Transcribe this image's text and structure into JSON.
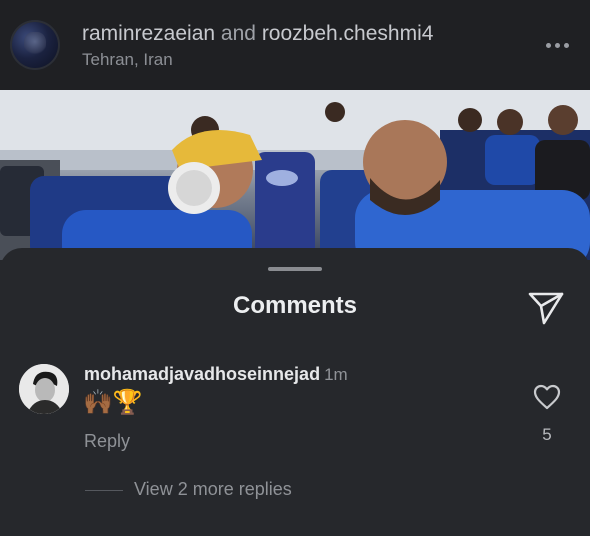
{
  "post": {
    "user1": "raminrezaeian",
    "joiner": "and",
    "user2": "roozbeh.cheshmi4",
    "location": "Tehran, Iran",
    "more_icon": "more-horizontal-icon"
  },
  "comments_sheet": {
    "title": "Comments",
    "share_icon": "paper-plane-icon"
  },
  "comment": {
    "username": "mohamadjavadhoseinnejad",
    "time": "1m",
    "text": "🙌🏾🏆",
    "reply_label": "Reply",
    "like_icon": "heart-outline-icon",
    "like_count": "5",
    "view_replies": "View 2 more replies"
  },
  "colors": {
    "background": "#26282c",
    "header": "#1f2023",
    "muted_text": "#8f9297",
    "primary_text": "#e9eaec"
  }
}
